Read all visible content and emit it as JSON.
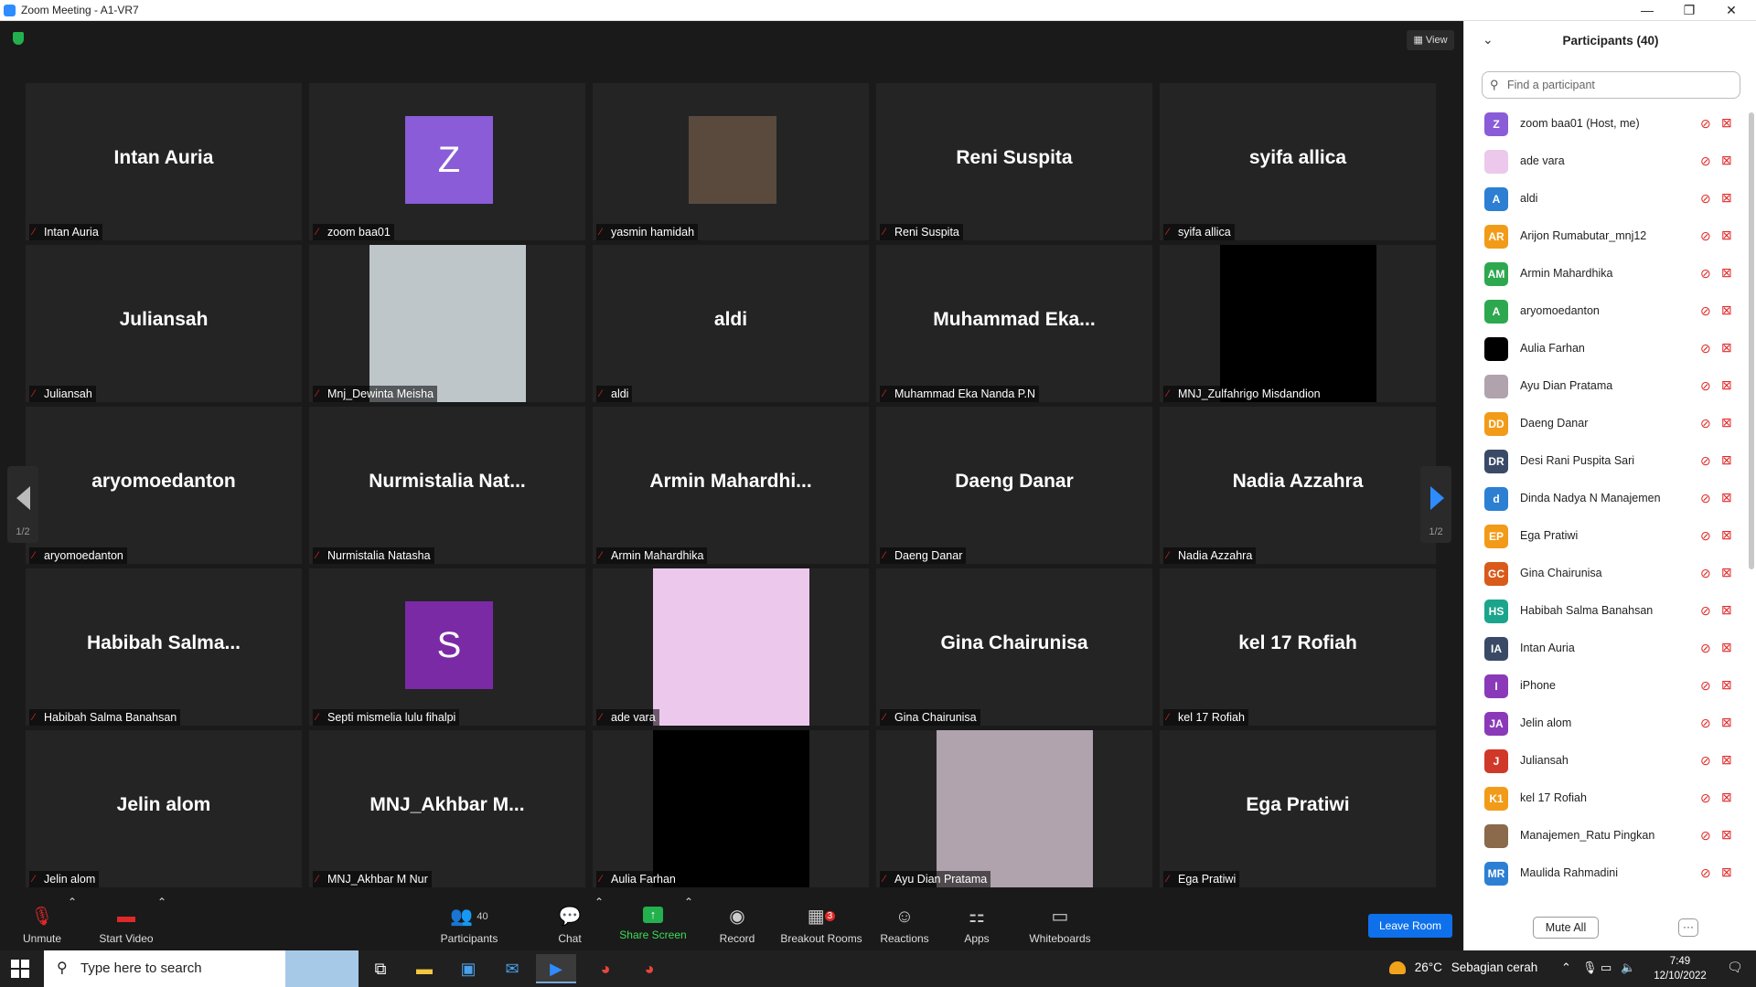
{
  "titlebar": {
    "title": "Zoom Meeting - A1-VR7",
    "minimize": "—",
    "maximize": "❐",
    "close": "✕"
  },
  "meeting": {
    "view_label": "View",
    "page_indicator": "1/2",
    "tiles": [
      {
        "kind": "name",
        "display": "Intan Auria",
        "label": "Intan Auria"
      },
      {
        "kind": "avatar",
        "initial": "Z",
        "color": "#8a5cd8",
        "label": "zoom baa01"
      },
      {
        "kind": "photo",
        "color": "#5a4a3e",
        "label": "yasmin hamidah"
      },
      {
        "kind": "name",
        "display": "Reni Suspita",
        "label": "Reni Suspita"
      },
      {
        "kind": "name",
        "display": "syifa allica",
        "label": "syifa allica"
      },
      {
        "kind": "name",
        "display": "Juliansah",
        "label": "Juliansah"
      },
      {
        "kind": "block",
        "color": "#bfc6ca",
        "label": "Mnj_Dewinta Meisha"
      },
      {
        "kind": "name",
        "display": "aldi",
        "label": "aldi"
      },
      {
        "kind": "name",
        "display": "Muhammad  Eka...",
        "label": "Muhammad Eka Nanda P.N"
      },
      {
        "kind": "block",
        "color": "#000000",
        "label": "MNJ_Zulfahrigo Misdandion"
      },
      {
        "kind": "name",
        "display": "aryomoedanton",
        "label": "aryomoedanton"
      },
      {
        "kind": "name",
        "display": "Nurmistalia  Nat...",
        "label": "Nurmistalia Natasha"
      },
      {
        "kind": "name",
        "display": "Armin  Mahardhi...",
        "label": "Armin Mahardhika"
      },
      {
        "kind": "name",
        "display": "Daeng Danar",
        "label": "Daeng Danar"
      },
      {
        "kind": "name",
        "display": "Nadia Azzahra",
        "label": "Nadia Azzahra"
      },
      {
        "kind": "name",
        "display": "Habibah  Salma...",
        "label": "Habibah Salma Banahsan"
      },
      {
        "kind": "avatar",
        "initial": "S",
        "color": "#7b2aa6",
        "label": "Septi mismelia lulu fihalpi"
      },
      {
        "kind": "block",
        "color": "#ecc8ec",
        "label": "ade vara"
      },
      {
        "kind": "name",
        "display": "Gina Chairunisa",
        "label": "Gina Chairunisa"
      },
      {
        "kind": "name",
        "display": "kel 17 Rofiah",
        "label": "kel 17 Rofiah"
      },
      {
        "kind": "name",
        "display": "Jelin alom",
        "label": "Jelin alom"
      },
      {
        "kind": "name",
        "display": "MNJ_Akhbar  M...",
        "label": "MNJ_Akhbar M Nur"
      },
      {
        "kind": "block",
        "color": "#000000",
        "label": "Aulia Farhan"
      },
      {
        "kind": "block",
        "color": "#b0a3ad",
        "label": "Ayu Dian Pratama"
      },
      {
        "kind": "name",
        "display": "Ega Pratiwi",
        "label": "Ega Pratiwi"
      }
    ]
  },
  "toolbar": {
    "unmute": "Unmute",
    "start_video": "Start Video",
    "participants": "Participants",
    "participants_count": "40",
    "chat": "Chat",
    "share_screen": "Share Screen",
    "record": "Record",
    "breakout_rooms": "Breakout Rooms",
    "breakout_badge": "3",
    "reactions": "Reactions",
    "apps": "Apps",
    "whiteboards": "Whiteboards",
    "leave_room": "Leave Room"
  },
  "panel": {
    "title": "Participants (40)",
    "search_placeholder": "Find a participant",
    "mute_all": "Mute All",
    "more": "···",
    "participants": [
      {
        "initials": "Z",
        "color": "#8a5cd8",
        "name": "zoom baa01 (Host, me)"
      },
      {
        "initials": "",
        "color": "#ecc8ec",
        "name": "ade vara"
      },
      {
        "initials": "A",
        "color": "#2d7fd3",
        "name": "aldi"
      },
      {
        "initials": "AR",
        "color": "#f29b18",
        "name": "Arijon Rumabutar_mnj12"
      },
      {
        "initials": "AM",
        "color": "#2ea84f",
        "name": "Armin Mahardhika"
      },
      {
        "initials": "A",
        "color": "#2ea84f",
        "name": "aryomoedanton"
      },
      {
        "initials": "",
        "color": "#000000",
        "name": "Aulia Farhan"
      },
      {
        "initials": "",
        "color": "#b0a3ad",
        "name": "Ayu Dian Pratama"
      },
      {
        "initials": "DD",
        "color": "#f29b18",
        "name": "Daeng Danar"
      },
      {
        "initials": "DR",
        "color": "#3a4a66",
        "name": "Desi Rani Puspita Sari"
      },
      {
        "initials": "d",
        "color": "#2d7fd3",
        "name": "Dinda Nadya N Manajemen"
      },
      {
        "initials": "EP",
        "color": "#f29b18",
        "name": "Ega Pratiwi"
      },
      {
        "initials": "GC",
        "color": "#d95a1a",
        "name": "Gina Chairunisa"
      },
      {
        "initials": "HS",
        "color": "#1aa58c",
        "name": "Habibah Salma Banahsan"
      },
      {
        "initials": "IA",
        "color": "#3a4a66",
        "name": "Intan Auria"
      },
      {
        "initials": "I",
        "color": "#8a3ab8",
        "name": "iPhone"
      },
      {
        "initials": "JA",
        "color": "#8a3ab8",
        "name": "Jelin alom"
      },
      {
        "initials": "J",
        "color": "#d0382a",
        "name": "Juliansah"
      },
      {
        "initials": "K1",
        "color": "#f29b18",
        "name": "kel 17 Rofiah"
      },
      {
        "initials": "",
        "color": "#8a6a4a",
        "name": "Manajemen_Ratu Pingkan"
      },
      {
        "initials": "MR",
        "color": "#2d7fd3",
        "name": "Maulida Rahmadini"
      }
    ]
  },
  "taskbar": {
    "search_placeholder": "Type here to search",
    "temperature": "26°C",
    "weather": "Sebagian cerah",
    "time": "7:49",
    "date": "12/10/2022"
  }
}
